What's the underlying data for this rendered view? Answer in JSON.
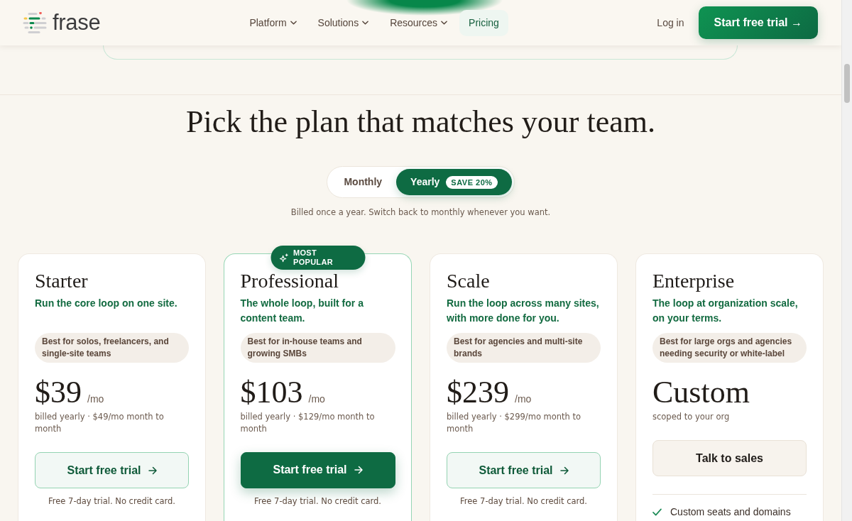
{
  "header": {
    "logo": "frase",
    "nav": [
      {
        "label": "Platform",
        "has_menu": true,
        "selected": false
      },
      {
        "label": "Solutions",
        "has_menu": true,
        "selected": false
      },
      {
        "label": "Resources",
        "has_menu": true,
        "selected": false
      },
      {
        "label": "Pricing",
        "has_menu": false,
        "selected": true
      }
    ],
    "login": "Log in",
    "cta": "Start free trial →"
  },
  "pricing": {
    "title": "Pick the plan that matches your team.",
    "billing_toggle": [
      {
        "label": "Monthly",
        "selected": false
      },
      {
        "label": "Yearly",
        "selected": true,
        "badge": "SAVE 20%"
      }
    ],
    "billing_note": "Billed once a year. Switch back to monthly whenever you want."
  },
  "plans": [
    {
      "name": "Starter",
      "featured": false,
      "tagline": "Run the core loop on one site.",
      "best_for": "Best for solos, freelancers, and single-site teams",
      "price": "$39",
      "price_unit": "/mo",
      "price_note": "billed yearly · $49/mo month to month",
      "cta": {
        "label": "Start free trial",
        "kind": "outline",
        "arrow": true
      },
      "footnote": "Free 7-day trial. No credit card."
    },
    {
      "name": "Professional",
      "featured": true,
      "badge": "MOST POPULAR",
      "tagline": "The whole loop, built for a content team.",
      "best_for": "Best for in-house teams and growing SMBs",
      "price": "$103",
      "price_unit": "/mo",
      "price_note": "billed yearly · $129/mo month to month",
      "cta": {
        "label": "Start free trial",
        "kind": "solid",
        "arrow": true
      },
      "footnote": "Free 7-day trial. No credit card."
    },
    {
      "name": "Scale",
      "featured": false,
      "tagline": "Run the loop across many sites, with more done for you.",
      "best_for": "Best for agencies and multi-site brands",
      "price": "$239",
      "price_unit": "/mo",
      "price_note": "billed yearly · $299/mo month to month",
      "cta": {
        "label": "Start free trial",
        "kind": "outline",
        "arrow": true
      },
      "footnote": "Free 7-day trial. No credit card."
    },
    {
      "name": "Enterprise",
      "featured": false,
      "tagline": "The loop at organization scale, on your terms.",
      "best_for": "Best for large orgs and agencies needing security or white-label",
      "price": "Custom",
      "price_note": "scoped to your org",
      "cta": {
        "label": "Talk to sales",
        "kind": "neutral",
        "arrow": false
      },
      "features": [
        {
          "text": "Custom seats and domains",
          "included": true
        }
      ]
    }
  ]
}
